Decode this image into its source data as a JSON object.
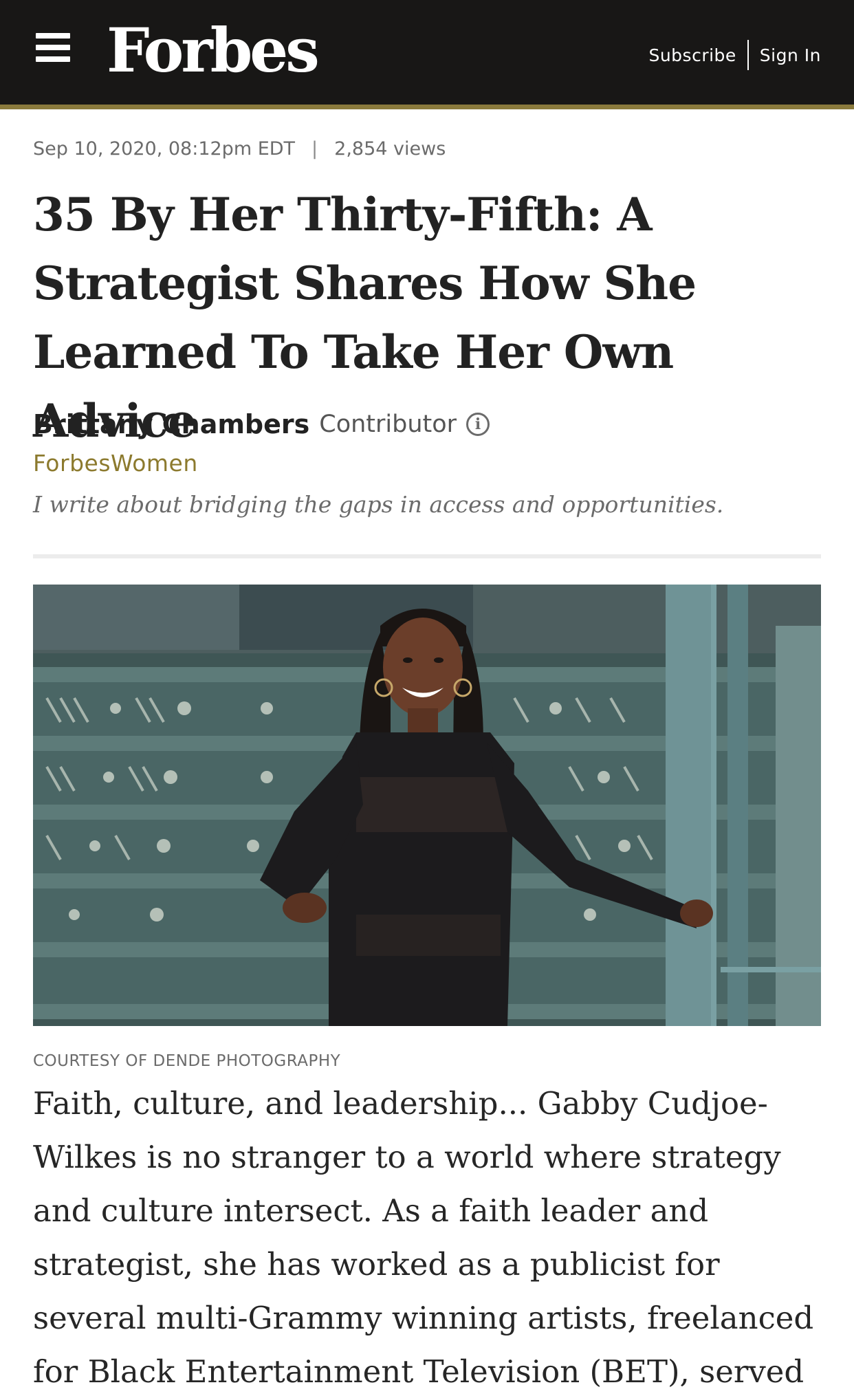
{
  "header": {
    "logo": "Forbes",
    "subscribe_label": "Subscribe",
    "signin_label": "Sign In"
  },
  "meta": {
    "date": "Sep 10, 2020, 08:12pm EDT",
    "separator": "|",
    "views": "2,854 views"
  },
  "article": {
    "headline": "35 By Her Thirty-Fifth: A Strategist Shares How She Learned To Take Her Own Advice",
    "author": "Brittany Chambers",
    "role": "Contributor",
    "channel": "ForbesWomen",
    "bio": "I write about bridging the gaps in access and opportunities.",
    "image_caption": "COURTESY OF DENDE PHOTOGRAPHY",
    "body": "Faith, culture, and leadership... Gabby Cudjoe-Wilkes is no stranger to a world where strategy and culture intersect. As a faith leader and strategist, she has worked as a publicist for several multi-Grammy winning artists, freelanced for Black Entertainment Television (BET), served as the senior brand strategist"
  },
  "colors": {
    "topbar": "#181716",
    "accent": "#8a7a3c",
    "channel": "#8c7a2e"
  }
}
